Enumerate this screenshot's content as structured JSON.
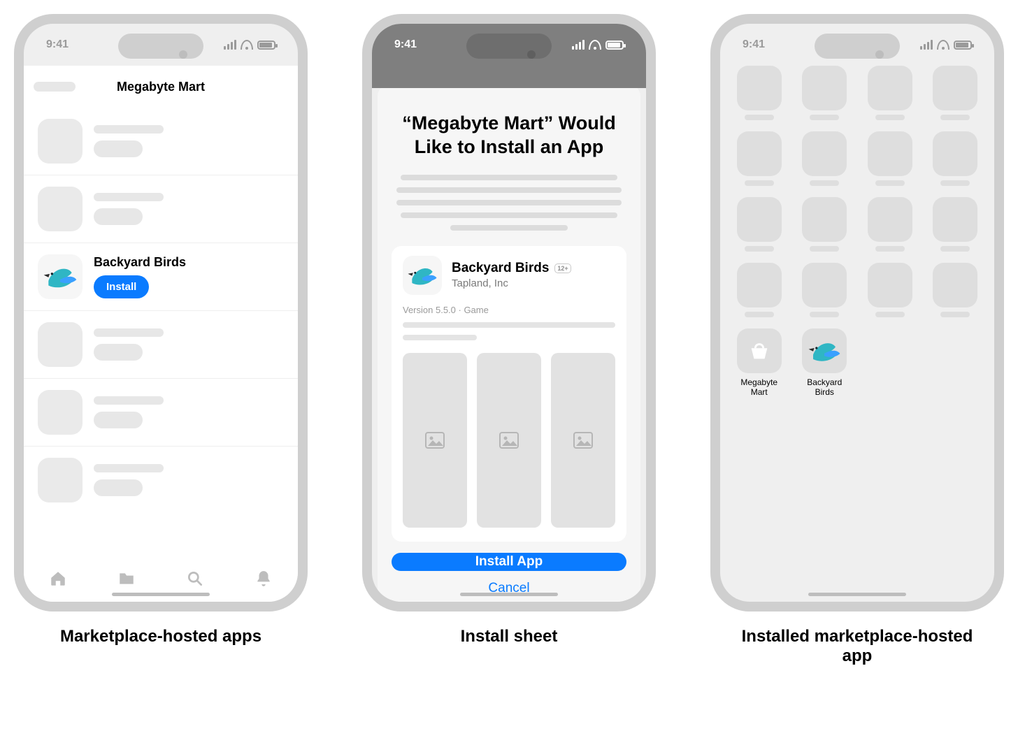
{
  "status_time": "9:41",
  "screen1": {
    "nav_title": "Megabyte Mart",
    "app_name": "Backyard Birds",
    "install_label": "Install",
    "caption": "Marketplace-hosted apps"
  },
  "screen2": {
    "title_line1": "“Megabyte Mart” Would",
    "title_line2": "Like to Install an App",
    "app_name": "Backyard Birds",
    "publisher": "Tapland, Inc",
    "age_rating": "12+",
    "meta": "Version 5.5.0 · Game",
    "install_btn": "Install App",
    "cancel_btn": "Cancel",
    "caption": "Install sheet"
  },
  "screen3": {
    "app1_label": "Megabyte\nMart",
    "app2_label": "Backyard\nBirds",
    "caption": "Installed marketplace-hosted app"
  }
}
